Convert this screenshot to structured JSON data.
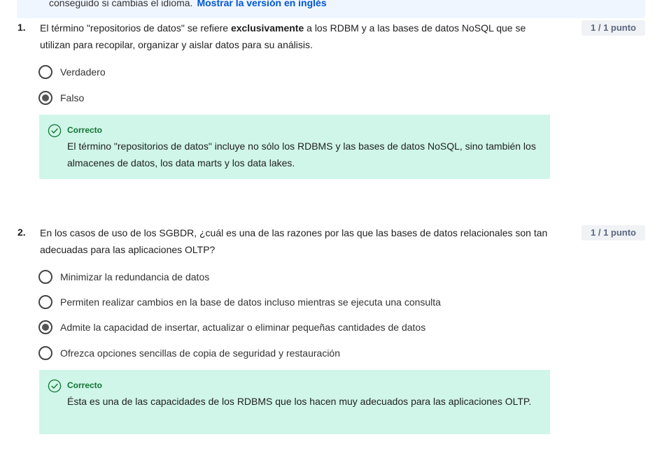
{
  "banner": {
    "text": "conseguido si cambias el idioma.",
    "link": "Mostrar la versión en inglés"
  },
  "questions": [
    {
      "number": "1.",
      "text_before": "El término \"repositorios de datos\" se refiere ",
      "text_bold": "exclusivamente",
      "text_after": " a los RDBM y a las bases de datos NoSQL que se utilizan para recopilar, organizar y aislar datos para su análisis.",
      "points": "1 / 1 punto",
      "options": [
        {
          "label": "Verdadero",
          "selected": false
        },
        {
          "label": "Falso",
          "selected": true
        }
      ],
      "feedback": {
        "title": "Correcto",
        "text": "El término \"repositorios de datos\" incluye no sólo los RDBMS y las bases de datos NoSQL, sino también los almacenes de datos, los data marts y los data lakes."
      }
    },
    {
      "number": "2.",
      "text": "En los casos de uso de los SGBDR, ¿cuál es una de las razones por las que las bases de datos relacionales son tan adecuadas para las aplicaciones OLTP?",
      "points": "1 / 1 punto",
      "options": [
        {
          "label": "Minimizar la redundancia de datos",
          "selected": false
        },
        {
          "label": "Permiten realizar cambios en la base de datos incluso mientras se ejecuta una consulta",
          "selected": false
        },
        {
          "label": "Admite la capacidad de insertar, actualizar o eliminar pequeñas cantidades de datos",
          "selected": true
        },
        {
          "label": "Ofrezca opciones sencillas de copia de seguridad y restauración",
          "selected": false
        }
      ],
      "feedback": {
        "title": "Correcto",
        "text": "Ésta es una de las capacidades de los RDBMS que los hacen muy adecuados para las aplicaciones OLTP."
      }
    }
  ],
  "colors": {
    "feedback_bg": "#cff6e8",
    "correct_green": "#137333",
    "link_blue": "#0056d2",
    "banner_bg": "#f0f6ff",
    "points_bg": "#f0f2f5"
  },
  "icons": {
    "correct": "check-circle-icon",
    "radio_checked": "radio-checked-icon",
    "radio_unchecked": "radio-unchecked-icon"
  }
}
